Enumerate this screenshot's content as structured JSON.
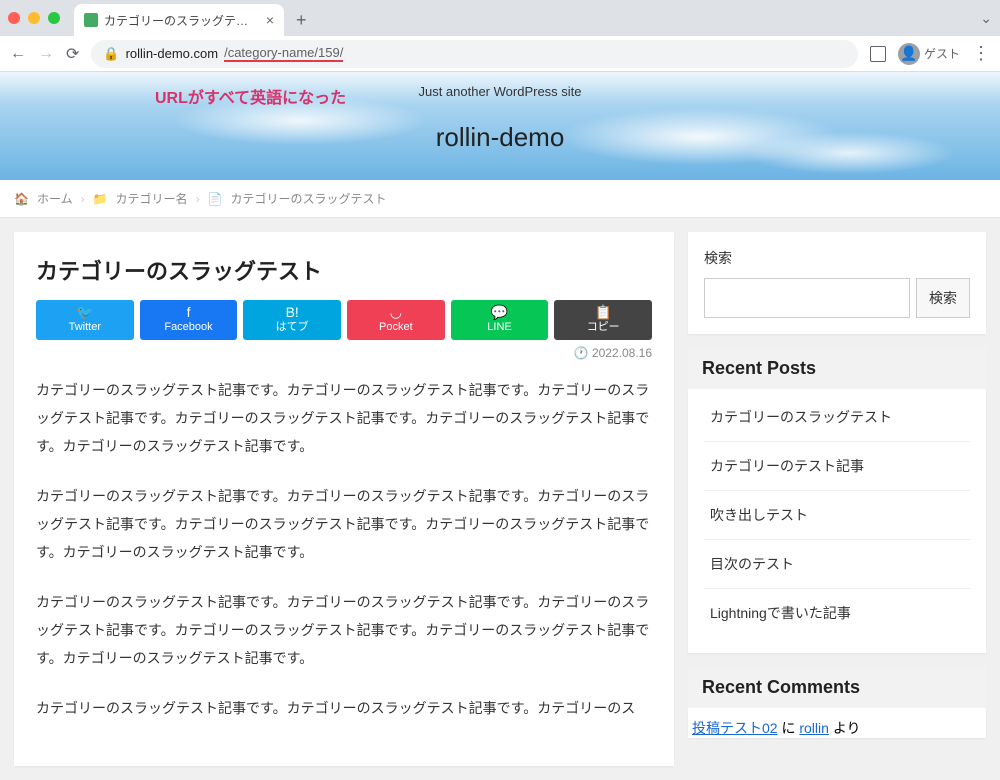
{
  "browser": {
    "tab_title": "カテゴリーのスラッグテスト | roll...",
    "url_host": "rollin-demo.com",
    "url_path": "/category-name/159/",
    "guest_label": "ゲスト"
  },
  "hero": {
    "annotation": "URLがすべて英語になった",
    "tagline": "Just another WordPress site",
    "site_title": "rollin-demo"
  },
  "breadcrumb": {
    "home": "ホーム",
    "category": "カテゴリー名",
    "current": "カテゴリーのスラッグテスト"
  },
  "article": {
    "title": "カテゴリーのスラッグテスト",
    "date": "2022.08.16",
    "share": {
      "twitter": "Twitter",
      "facebook": "Facebook",
      "hatena": "はてブ",
      "hatena_icon": "B!",
      "pocket": "Pocket",
      "line": "LINE",
      "copy": "コピー"
    },
    "paragraphs": [
      "カテゴリーのスラッグテスト記事です。カテゴリーのスラッグテスト記事です。カテゴリーのスラッグテスト記事です。カテゴリーのスラッグテスト記事です。カテゴリーのスラッグテスト記事です。カテゴリーのスラッグテスト記事です。",
      "カテゴリーのスラッグテスト記事です。カテゴリーのスラッグテスト記事です。カテゴリーのスラッグテスト記事です。カテゴリーのスラッグテスト記事です。カテゴリーのスラッグテスト記事です。カテゴリーのスラッグテスト記事です。",
      "カテゴリーのスラッグテスト記事です。カテゴリーのスラッグテスト記事です。カテゴリーのスラッグテスト記事です。カテゴリーのスラッグテスト記事です。カテゴリーのスラッグテスト記事です。カテゴリーのスラッグテスト記事です。",
      "カテゴリーのスラッグテスト記事です。カテゴリーのスラッグテスト記事です。カテゴリーのス"
    ]
  },
  "sidebar": {
    "search_label": "検索",
    "search_button": "検索",
    "recent_posts_title": "Recent Posts",
    "recent_posts": [
      "カテゴリーのスラッグテスト",
      "カテゴリーのテスト記事",
      "吹き出しテスト",
      "目次のテスト",
      "Lightningで書いた記事"
    ],
    "recent_comments_title": "Recent Comments",
    "comment_post": "投稿テスト02",
    "comment_mid": " に ",
    "comment_author": "rollin",
    "comment_suffix": " より"
  }
}
